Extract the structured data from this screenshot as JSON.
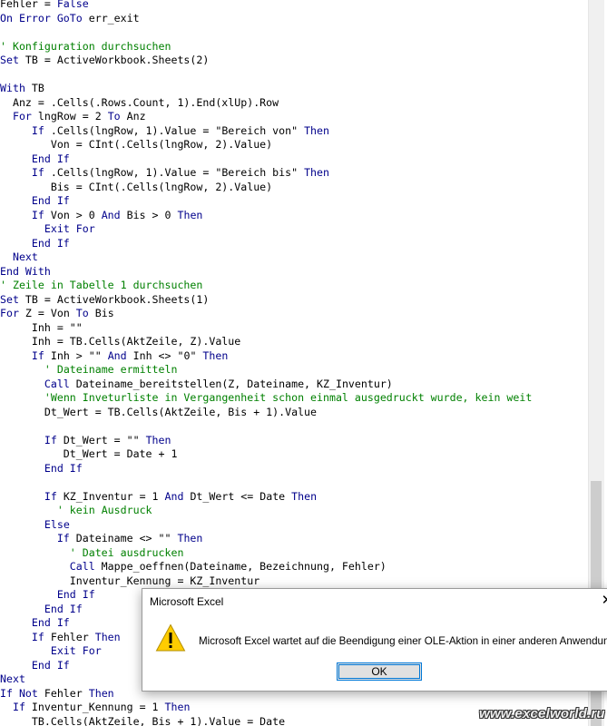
{
  "code_lines": [
    [
      [
        "tx",
        "Fehler = "
      ],
      [
        "kw",
        "False"
      ]
    ],
    [
      [
        "kw",
        "On Error GoTo"
      ],
      [
        "tx",
        " err_exit"
      ]
    ],
    [],
    [
      [
        "cm",
        "' Konfiguration durchsuchen"
      ]
    ],
    [
      [
        "kw",
        "Set"
      ],
      [
        "tx",
        " TB = ActiveWorkbook.Sheets(2)"
      ]
    ],
    [],
    [
      [
        "kw",
        "With"
      ],
      [
        "tx",
        " TB"
      ]
    ],
    [
      [
        "tx",
        "  Anz = .Cells(.Rows.Count, 1).End(xlUp).Row"
      ]
    ],
    [
      [
        "tx",
        "  "
      ],
      [
        "kw",
        "For"
      ],
      [
        "tx",
        " lngRow = 2 "
      ],
      [
        "kw",
        "To"
      ],
      [
        "tx",
        " Anz"
      ]
    ],
    [
      [
        "tx",
        "     "
      ],
      [
        "kw",
        "If"
      ],
      [
        "tx",
        " .Cells(lngRow, 1).Value = \"Bereich von\" "
      ],
      [
        "kw",
        "Then"
      ]
    ],
    [
      [
        "tx",
        "        Von = CInt(.Cells(lngRow, 2).Value)"
      ]
    ],
    [
      [
        "tx",
        "     "
      ],
      [
        "kw",
        "End If"
      ]
    ],
    [
      [
        "tx",
        "     "
      ],
      [
        "kw",
        "If"
      ],
      [
        "tx",
        " .Cells(lngRow, 1).Value = \"Bereich bis\" "
      ],
      [
        "kw",
        "Then"
      ]
    ],
    [
      [
        "tx",
        "        Bis = CInt(.Cells(lngRow, 2).Value)"
      ]
    ],
    [
      [
        "tx",
        "     "
      ],
      [
        "kw",
        "End If"
      ]
    ],
    [
      [
        "tx",
        "     "
      ],
      [
        "kw",
        "If"
      ],
      [
        "tx",
        " Von > 0 "
      ],
      [
        "kw",
        "And"
      ],
      [
        "tx",
        " Bis > 0 "
      ],
      [
        "kw",
        "Then"
      ]
    ],
    [
      [
        "tx",
        "       "
      ],
      [
        "kw",
        "Exit For"
      ]
    ],
    [
      [
        "tx",
        "     "
      ],
      [
        "kw",
        "End If"
      ]
    ],
    [
      [
        "tx",
        "  "
      ],
      [
        "kw",
        "Next"
      ]
    ],
    [
      [
        "kw",
        "End With"
      ]
    ],
    [
      [
        "cm",
        "' Zeile in Tabelle 1 durchsuchen"
      ]
    ],
    [
      [
        "kw",
        "Set"
      ],
      [
        "tx",
        " TB = ActiveWorkbook.Sheets(1)"
      ]
    ],
    [
      [
        "kw",
        "For"
      ],
      [
        "tx",
        " Z = Von "
      ],
      [
        "kw",
        "To"
      ],
      [
        "tx",
        " Bis"
      ]
    ],
    [
      [
        "tx",
        "     Inh = \"\""
      ]
    ],
    [
      [
        "tx",
        "     Inh = TB.Cells(AktZeile, Z).Value"
      ]
    ],
    [
      [
        "tx",
        "     "
      ],
      [
        "kw",
        "If"
      ],
      [
        "tx",
        " Inh > \"\" "
      ],
      [
        "kw",
        "And"
      ],
      [
        "tx",
        " Inh <> \"0\" "
      ],
      [
        "kw",
        "Then"
      ]
    ],
    [
      [
        "tx",
        "       "
      ],
      [
        "cm",
        "' Dateiname ermitteln"
      ]
    ],
    [
      [
        "tx",
        "       "
      ],
      [
        "kw",
        "Call"
      ],
      [
        "tx",
        " Dateiname_bereitstellen(Z, Dateiname, KZ_Inventur)"
      ]
    ],
    [
      [
        "tx",
        "       "
      ],
      [
        "cm",
        "'Wenn Inveturliste in Vergangenheit schon einmal ausgedruckt wurde, kein weit"
      ]
    ],
    [
      [
        "tx",
        "       Dt_Wert = TB.Cells(AktZeile, Bis + 1).Value"
      ]
    ],
    [],
    [
      [
        "tx",
        "       "
      ],
      [
        "kw",
        "If"
      ],
      [
        "tx",
        " Dt_Wert = \"\" "
      ],
      [
        "kw",
        "Then"
      ]
    ],
    [
      [
        "tx",
        "          Dt_Wert = Date + 1"
      ]
    ],
    [
      [
        "tx",
        "       "
      ],
      [
        "kw",
        "End If"
      ]
    ],
    [],
    [
      [
        "tx",
        "       "
      ],
      [
        "kw",
        "If"
      ],
      [
        "tx",
        " KZ_Inventur = 1 "
      ],
      [
        "kw",
        "And"
      ],
      [
        "tx",
        " Dt_Wert <= Date "
      ],
      [
        "kw",
        "Then"
      ]
    ],
    [
      [
        "tx",
        "         "
      ],
      [
        "cm",
        "' kein Ausdruck"
      ]
    ],
    [
      [
        "tx",
        "       "
      ],
      [
        "kw",
        "Else"
      ]
    ],
    [
      [
        "tx",
        "         "
      ],
      [
        "kw",
        "If"
      ],
      [
        "tx",
        " Dateiname <> \"\" "
      ],
      [
        "kw",
        "Then"
      ]
    ],
    [
      [
        "tx",
        "           "
      ],
      [
        "cm",
        "' Datei ausdrucken"
      ]
    ],
    [
      [
        "tx",
        "           "
      ],
      [
        "kw",
        "Call"
      ],
      [
        "tx",
        " Mappe_oeffnen(Dateiname, Bezeichnung, Fehler)"
      ]
    ],
    [
      [
        "tx",
        "           Inventur_Kennung = KZ_Inventur"
      ]
    ],
    [
      [
        "tx",
        "         "
      ],
      [
        "kw",
        "End If"
      ]
    ],
    [
      [
        "tx",
        "       "
      ],
      [
        "kw",
        "End If"
      ]
    ],
    [
      [
        "tx",
        "     "
      ],
      [
        "kw",
        "End If"
      ]
    ],
    [
      [
        "tx",
        "     "
      ],
      [
        "kw",
        "If"
      ],
      [
        "tx",
        " Fehler "
      ],
      [
        "kw",
        "Then"
      ]
    ],
    [
      [
        "tx",
        "        "
      ],
      [
        "kw",
        "Exit For"
      ]
    ],
    [
      [
        "tx",
        "     "
      ],
      [
        "kw",
        "End If"
      ]
    ],
    [
      [
        "kw",
        "Next"
      ]
    ],
    [
      [
        "kw",
        "If Not"
      ],
      [
        "tx",
        " Fehler "
      ],
      [
        "kw",
        "Then"
      ]
    ],
    [
      [
        "tx",
        "  "
      ],
      [
        "kw",
        "If"
      ],
      [
        "tx",
        " Inventur_Kennung = 1 "
      ],
      [
        "kw",
        "Then"
      ]
    ],
    [
      [
        "tx",
        "     TB.Cells(AktZeile, Bis + 1).Value = Date"
      ]
    ]
  ],
  "dialog": {
    "title": "Microsoft Excel",
    "close_glyph": "✕",
    "message": "Microsoft Excel wartet auf die Beendigung einer OLE-Aktion in einer anderen Anwendung.",
    "ok_label": "OK",
    "icon": "warning-icon",
    "icon_color": "#ffcc00"
  },
  "watermark": "www.excelworld.ru",
  "colors": {
    "keyword": "#00008b",
    "comment": "#008000",
    "text": "#000000"
  }
}
